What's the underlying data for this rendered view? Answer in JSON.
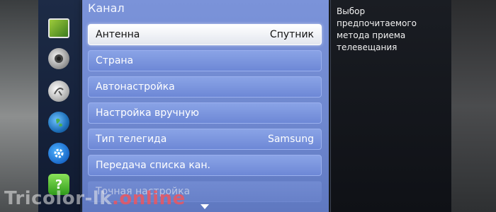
{
  "menu": {
    "title": "Канал",
    "items": [
      {
        "label": "Антенна",
        "value": "Спутник"
      },
      {
        "label": "Страна",
        "value": ""
      },
      {
        "label": "Автонастройка",
        "value": ""
      },
      {
        "label": "Настройка вручную",
        "value": ""
      },
      {
        "label": "Тип телегида",
        "value": "Samsung"
      },
      {
        "label": "Передача списка кан.",
        "value": ""
      },
      {
        "label": "Точная настройка",
        "value": ""
      }
    ]
  },
  "info": {
    "text": "Выбор предпочитаемого метода приема телевещания"
  },
  "sidebar_icons": [
    "picture-icon",
    "sound-icon",
    "channel-icon",
    "network-icon",
    "system-icon",
    "support-icon"
  ],
  "watermark": {
    "prefix": "Tricolor-lk",
    "suffix": ".online"
  },
  "colors": {
    "menu_bg": "#6f88cf",
    "selected_bg": "#ffffff",
    "info_bg": "#15181d"
  }
}
